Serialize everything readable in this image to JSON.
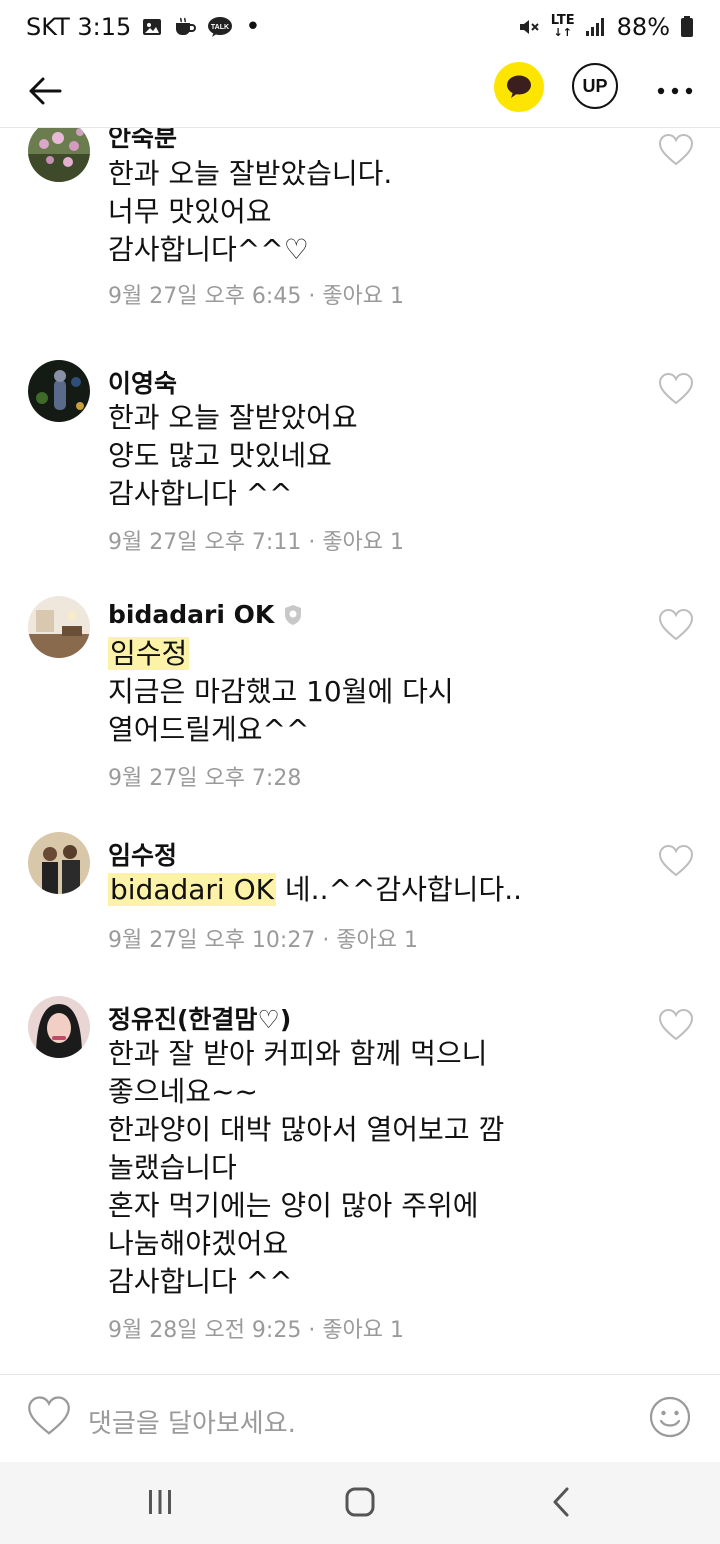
{
  "status_bar": {
    "carrier_time": "SKT 3:15",
    "talk_badge": "TALK",
    "network": "LTE",
    "battery": "88%",
    "icons": [
      "gallery-icon",
      "coffee-icon",
      "talk-icon",
      "mute-icon",
      "signal-icon",
      "battery-icon"
    ]
  },
  "header": {
    "up_label": "UP",
    "icons": [
      "back-arrow-icon",
      "talk-bubble-icon",
      "more-icon"
    ],
    "accent": "#fee500"
  },
  "comments": [
    {
      "author": "안숙분",
      "lines": [
        "한과 오늘 잘받았습니다.",
        "너무 맛있어요",
        "감사합니다^^♡"
      ],
      "meta": "9월 27일 오후 6:45 · 좋아요 1"
    },
    {
      "author": "이영숙",
      "lines": [
        "한과 오늘 잘받았어요",
        "양도 많고 맛있네요",
        "감사합니다 ^^"
      ],
      "meta": "9월 27일 오후 7:11 · 좋아요 1"
    },
    {
      "author": "bidadari OK",
      "mention": "임수정",
      "lines": [
        "지금은 마감했고 10월에 다시",
        "열어드릴게요^^"
      ],
      "meta": "9월 27일 오후 7:28"
    },
    {
      "author": "임수정",
      "mention": "bidadari OK",
      "lines": [
        " 네..^^감사합니다.."
      ],
      "meta": "9월 27일 오후 10:27 · 좋아요 1"
    },
    {
      "author": "정유진(한결맘♡)",
      "lines": [
        "한과 잘 받아 커피와 함께 먹으니",
        "좋으네요~~",
        "한과양이 대박 많아서 열어보고 깜",
        "놀랬습니다",
        "혼자 먹기에는 양이 많아 주위에",
        "나눔해야겠어요",
        "감사합니다 ^^"
      ],
      "meta": "9월 28일 오전 9:25 · 좋아요 1"
    }
  ],
  "input": {
    "placeholder": "댓글을 달아보세요."
  },
  "nav": {
    "icons": [
      "recent-apps-icon",
      "home-icon",
      "back-icon"
    ]
  }
}
